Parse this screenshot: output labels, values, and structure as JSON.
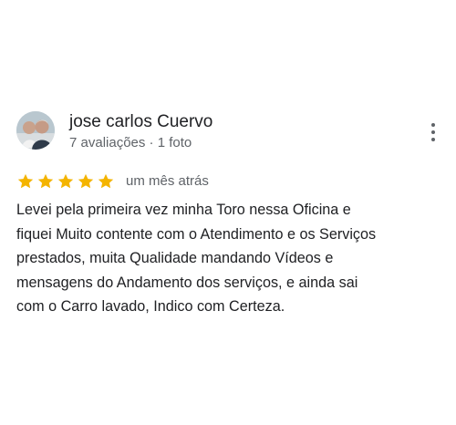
{
  "review": {
    "author": {
      "name": "jose carlos Cuervo",
      "meta": "7 avaliações · 1 foto"
    },
    "rating": {
      "value": 5,
      "max": 5,
      "star_color": "#f4b400"
    },
    "date": "um mês atrás",
    "text": "Levei pela primeira vez minha Toro nessa Oficina e\nfiquei Muito contente com o Atendimento e os Serviços\nprestados, muita Qualidade mandando Vídeos e\nmensagens do Andamento dos serviços, e ainda sai\ncom o Carro lavado, Indico com Certeza.",
    "menu_icon": "more-vert-icon"
  }
}
